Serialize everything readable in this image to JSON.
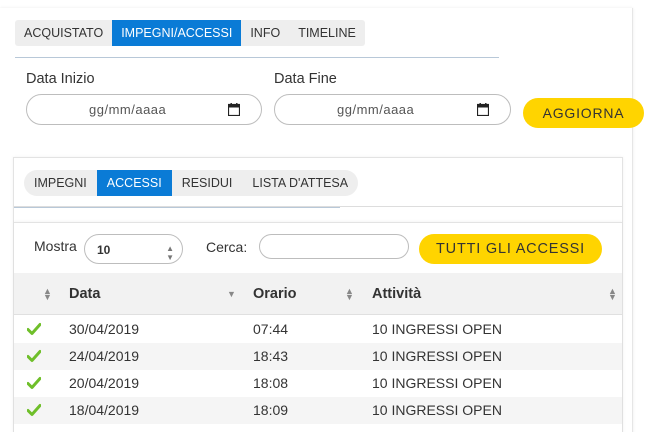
{
  "top_tabs": [
    "ACQUISTATO",
    "IMPEGNI/ACCESSI",
    "INFO",
    "TIMELINE"
  ],
  "filters": {
    "start_label": "Data Inizio",
    "end_label": "Data Fine",
    "date_placeholder": "gg/mm/aaaa",
    "update_button": "AGGIORNA"
  },
  "sub_tabs": [
    "IMPEGNI",
    "ACCESSI",
    "RESIDUI",
    "LISTA D'ATTESA"
  ],
  "table_controls": {
    "show_label": "Mostra",
    "show_value": "10",
    "search_label": "Cerca:",
    "all_access_button": "TUTTI GLI ACCESSI"
  },
  "table": {
    "headers": [
      "Data",
      "Orario",
      "Attività"
    ],
    "rows": [
      {
        "data": "30/04/2019",
        "orario": "07:44",
        "attivita": "10 INGRESSI OPEN"
      },
      {
        "data": "24/04/2019",
        "orario": "18:43",
        "attivita": "10 INGRESSI OPEN"
      },
      {
        "data": "20/04/2019",
        "orario": "18:08",
        "attivita": "10 INGRESSI OPEN"
      },
      {
        "data": "18/04/2019",
        "orario": "18:09",
        "attivita": "10 INGRESSI OPEN"
      }
    ]
  },
  "colors": {
    "accent": "#0a7bd6",
    "button": "#ffd400",
    "check": "#6fbf2a"
  }
}
